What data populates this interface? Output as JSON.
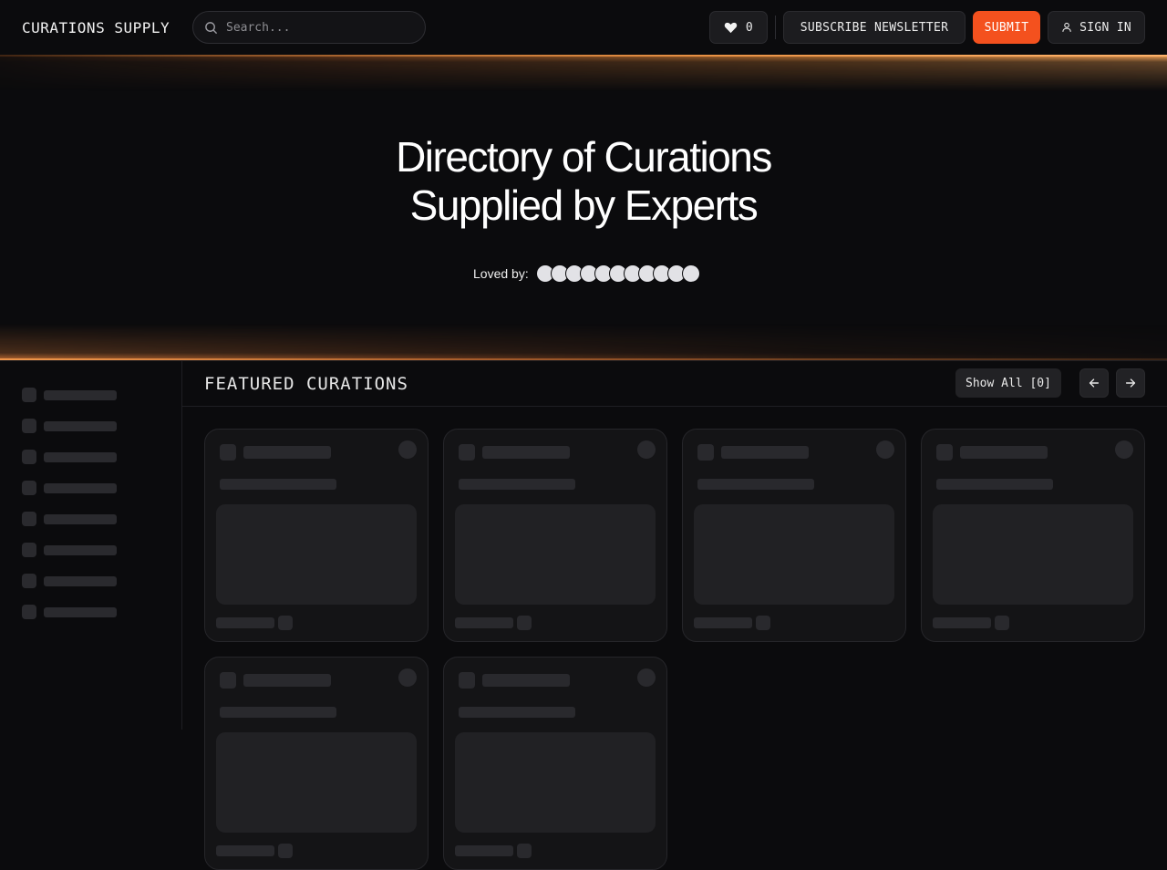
{
  "header": {
    "logo": "CURATIONS SUPPLY",
    "search_placeholder": "Search...",
    "likes_count": "0",
    "subscribe_label": "SUBSCRIBE NEWSLETTER",
    "submit_label": "SUBMIT",
    "signin_label": "SIGN IN"
  },
  "hero": {
    "title_line1": "Directory of Curations",
    "title_line2": "Supplied by Experts",
    "loved_label": "Loved by:",
    "avatar_count": 11
  },
  "sidebar": {
    "skeleton_item_count": 8
  },
  "featured": {
    "title": "FEATURED CURATIONS",
    "show_all_label": "Show All [0]",
    "skeleton_card_count": 6
  },
  "colors": {
    "background": "#0b0b0d",
    "accent": "#f4511e",
    "glow": "#ffb36b"
  },
  "icons": [
    "search-icon",
    "heart-icon",
    "user-icon",
    "arrow-left-icon",
    "arrow-right-icon"
  ]
}
